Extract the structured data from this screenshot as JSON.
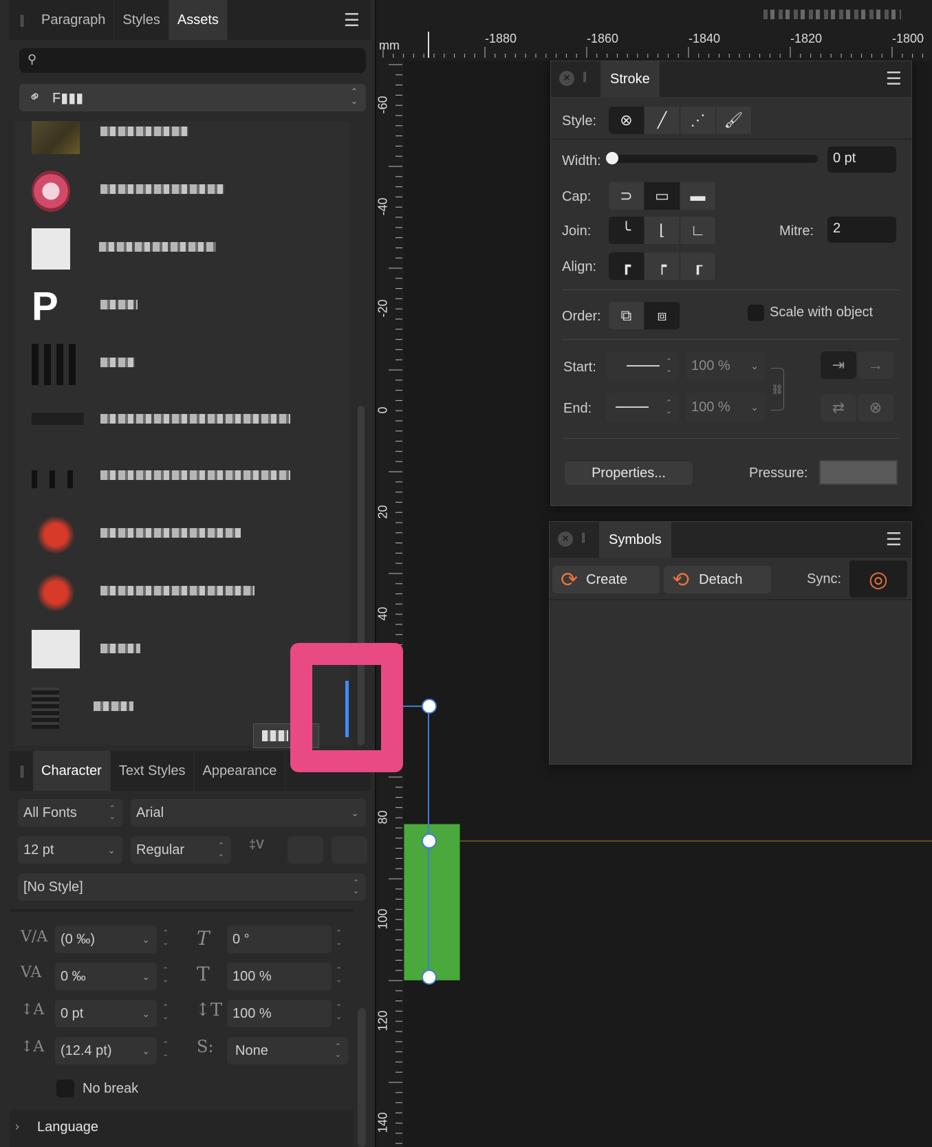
{
  "top_panel": {
    "tabs": [
      "Paragraph",
      "Styles",
      "Assets"
    ],
    "active_tab": "Assets",
    "search_placeholder": "",
    "category_name": "F▮▮▮"
  },
  "character_panel": {
    "tabs": [
      "Character",
      "Text Styles",
      "Appearance"
    ],
    "font_collection": "All Fonts",
    "font_family": "Arial",
    "font_size": "12 pt",
    "font_weight": "Regular",
    "style": "[No Style]",
    "kerning": "(0 ‰)",
    "tracking": "0 ‰",
    "baseline": "0 pt",
    "leading": "(12.4 pt)",
    "shear": "0 °",
    "vertical_scale": "100 %",
    "horizontal_scale": "100 %",
    "text_style": "None",
    "no_break_label": "No break",
    "language_label": "Language"
  },
  "ruler": {
    "unit": "mm",
    "top_ticks": [
      "-1880",
      "-1860",
      "-1840",
      "-1820",
      "-1800"
    ],
    "left_ticks": [
      "-60",
      "-40",
      "-20",
      "0",
      "20",
      "40",
      "80",
      "100",
      "120",
      "140"
    ]
  },
  "stroke_panel": {
    "title": "Stroke",
    "style_label": "Style:",
    "width_label": "Width:",
    "width_value": "0 pt",
    "cap_label": "Cap:",
    "join_label": "Join:",
    "mitre_label": "Mitre:",
    "mitre_value": "2",
    "align_label": "Align:",
    "order_label": "Order:",
    "scale_label": "Scale with object",
    "start_label": "Start:",
    "start_value": "100 %",
    "end_label": "End:",
    "end_value": "100 %",
    "properties_label": "Properties...",
    "pressure_label": "Pressure:"
  },
  "symbols_panel": {
    "title": "Symbols",
    "create_label": "Create",
    "detach_label": "Detach",
    "sync_label": "Sync:"
  },
  "colors": {
    "highlight": "#e94a84",
    "selection_rect": "#4aa83c",
    "accent_orange": "#e8743b",
    "handle_line": "#3f7dd6"
  }
}
